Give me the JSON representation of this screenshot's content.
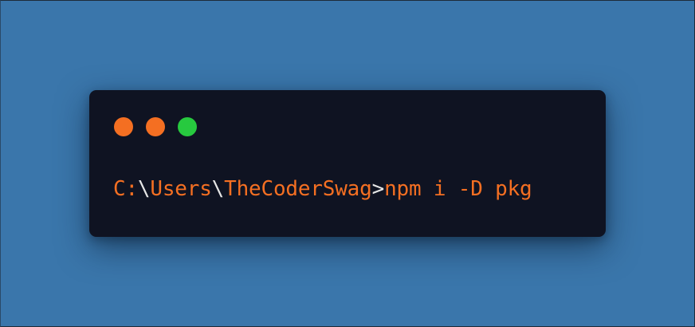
{
  "colors": {
    "background": "#3a76ab",
    "terminal_background": "#0f1322",
    "dot_close": "#f46f22",
    "dot_minimize": "#f46f22",
    "dot_maximize": "#27c93f",
    "path_text": "#f46f22",
    "separator_text": "#e6e6e6"
  },
  "window_controls": [
    {
      "name": "close",
      "color": "#f46f22"
    },
    {
      "name": "minimize",
      "color": "#f46f22"
    },
    {
      "name": "maximize",
      "color": "#27c93f"
    }
  ],
  "terminal": {
    "drive": "C:",
    "sep1": "\\",
    "dir1": "Users",
    "sep2": "\\",
    "dir2": "TheCoderSwag",
    "prompt_symbol": ">",
    "command": "npm i -D pkg"
  }
}
